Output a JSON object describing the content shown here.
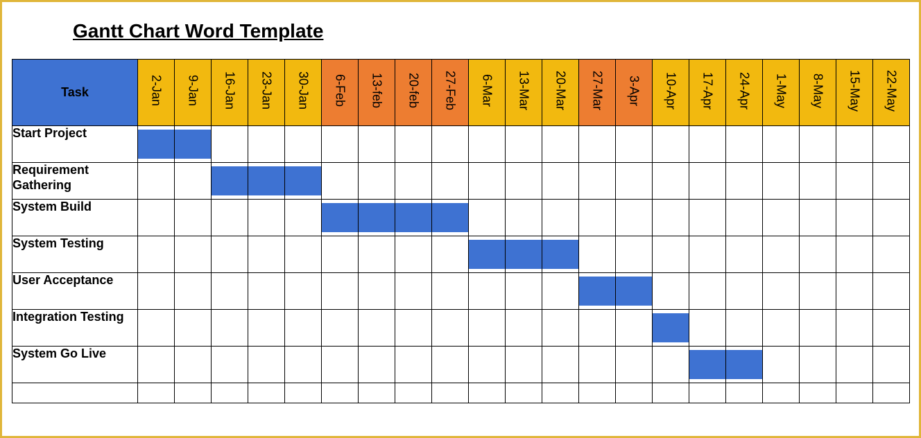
{
  "title": "Gantt Chart Word Template",
  "colors": {
    "headerBlue": "#3e72d2",
    "barBlue": "#3e72d2",
    "monthJan": "#f2b90f",
    "monthFeb": "#ed7d31",
    "monthMar": "#f2b90f",
    "monthMarLate": "#ed7d31",
    "monthApr": "#ed7d31",
    "monthAprLate": "#f2b90f",
    "monthMay": "#f2b90f"
  },
  "taskHeader": "Task",
  "dates": [
    {
      "label": "2-Jan",
      "colorKey": "monthJan"
    },
    {
      "label": "9-Jan",
      "colorKey": "monthJan"
    },
    {
      "label": "16-Jan",
      "colorKey": "monthJan"
    },
    {
      "label": "23-Jan",
      "colorKey": "monthJan"
    },
    {
      "label": "30-Jan",
      "colorKey": "monthJan"
    },
    {
      "label": "6-Feb",
      "colorKey": "monthFeb"
    },
    {
      "label": "13-feb",
      "colorKey": "monthFeb"
    },
    {
      "label": "20-feb",
      "colorKey": "monthFeb"
    },
    {
      "label": "27-Feb",
      "colorKey": "monthFeb"
    },
    {
      "label": "6-Mar",
      "colorKey": "monthMar"
    },
    {
      "label": "13-Mar",
      "colorKey": "monthMar"
    },
    {
      "label": "20-Mar",
      "colorKey": "monthMar"
    },
    {
      "label": "27-Mar",
      "colorKey": "monthMarLate"
    },
    {
      "label": "3-Apr",
      "colorKey": "monthApr"
    },
    {
      "label": "10-Apr",
      "colorKey": "monthAprLate"
    },
    {
      "label": "17-Apr",
      "colorKey": "monthAprLate"
    },
    {
      "label": "24-Apr",
      "colorKey": "monthAprLate"
    },
    {
      "label": "1-May",
      "colorKey": "monthMay"
    },
    {
      "label": "8-May",
      "colorKey": "monthMay"
    },
    {
      "label": "15-May",
      "colorKey": "monthMay"
    },
    {
      "label": "22-May",
      "colorKey": "monthMay"
    }
  ],
  "tasks": [
    {
      "name": "Start Project",
      "start": 0,
      "end": 1
    },
    {
      "name": "Requirement Gathering",
      "start": 2,
      "end": 4
    },
    {
      "name": "System Build",
      "start": 5,
      "end": 8
    },
    {
      "name": "System Testing",
      "start": 9,
      "end": 11
    },
    {
      "name": "User Acceptance",
      "start": 12,
      "end": 13
    },
    {
      "name": "Integration Testing",
      "start": 14,
      "end": 14
    },
    {
      "name": "System Go Live",
      "start": 15,
      "end": 16
    }
  ],
  "emptyRows": 1,
  "chart_data": {
    "type": "bar",
    "orientation": "horizontal-gantt",
    "title": "Gantt Chart Word Template",
    "x_categories": [
      "2-Jan",
      "9-Jan",
      "16-Jan",
      "23-Jan",
      "30-Jan",
      "6-Feb",
      "13-feb",
      "20-feb",
      "27-Feb",
      "6-Mar",
      "13-Mar",
      "20-Mar",
      "27-Mar",
      "3-Apr",
      "10-Apr",
      "17-Apr",
      "24-Apr",
      "1-May",
      "8-May",
      "15-May",
      "22-May"
    ],
    "tasks": [
      {
        "name": "Start Project",
        "start": "2-Jan",
        "end": "9-Jan"
      },
      {
        "name": "Requirement Gathering",
        "start": "16-Jan",
        "end": "30-Jan"
      },
      {
        "name": "System Build",
        "start": "6-Feb",
        "end": "27-Feb"
      },
      {
        "name": "System Testing",
        "start": "6-Mar",
        "end": "20-Mar"
      },
      {
        "name": "User Acceptance",
        "start": "27-Mar",
        "end": "3-Apr"
      },
      {
        "name": "Integration Testing",
        "start": "10-Apr",
        "end": "10-Apr"
      },
      {
        "name": "System Go Live",
        "start": "17-Apr",
        "end": "24-Apr"
      }
    ],
    "xlabel": "",
    "ylabel": "Task"
  }
}
